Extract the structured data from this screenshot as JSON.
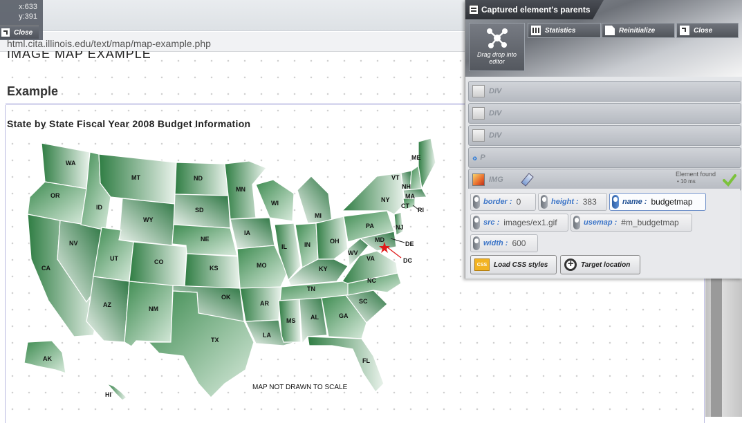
{
  "browser": {
    "url": "html.cita.illinois.edu/text/map/map-example.php"
  },
  "coords": {
    "x": "x:633",
    "y": "y:391",
    "close_label": "Close"
  },
  "page": {
    "heading_partial": "IMAGE MAP EXAMPLE",
    "section_title": "Example",
    "map_title": "State by State Fiscal Year 2008 Budget Information",
    "scale_note": "MAP NOT DRAWN TO SCALE",
    "state_labels": [
      "WA",
      "OR",
      "CA",
      "NV",
      "ID",
      "MT",
      "WY",
      "UT",
      "AZ",
      "CO",
      "NM",
      "ND",
      "SD",
      "NE",
      "KS",
      "OK",
      "TX",
      "MN",
      "IA",
      "MO",
      "AR",
      "LA",
      "WI",
      "IL",
      "MI",
      "IN",
      "OH",
      "KY",
      "TN",
      "MS",
      "AL",
      "GA",
      "FL",
      "SC",
      "NC",
      "VA",
      "WV",
      "PA",
      "NY",
      "VT",
      "NH",
      "ME",
      "MA",
      "CT",
      "RI",
      "NJ",
      "MD",
      "DE",
      "DC",
      "AK",
      "HI"
    ]
  },
  "panel": {
    "title": "Captured element's parents",
    "drag_drop_label": "Drag drop into editor",
    "statistics_label": "Statistics",
    "reinitialize_label": "Reinitialize",
    "close_label": "Close",
    "parents": [
      {
        "tag": "DIV"
      },
      {
        "tag": "DIV"
      },
      {
        "tag": "DIV"
      },
      {
        "tag": "P"
      },
      {
        "tag": "IMG"
      }
    ],
    "element_found": "Element found",
    "found_time": "10 ms",
    "attributes": {
      "border": {
        "key": "border :",
        "value": "0"
      },
      "height": {
        "key": "height :",
        "value": "383"
      },
      "name": {
        "key": "name :",
        "value": "budgetmap"
      },
      "src": {
        "key": "src :",
        "value": "images/ex1.gif"
      },
      "usemap": {
        "key": "usemap :",
        "value": "#m_budgetmap"
      },
      "width": {
        "key": "width :",
        "value": "600"
      }
    },
    "load_css_label": "Load CSS styles",
    "css_icon_text": "CSS",
    "target_location_label": "Target location"
  },
  "colors": {
    "map_green_dark": "#2f7d43",
    "map_green_light": "#eaf3ec",
    "accent_blue": "#3b74c7",
    "dc_marker": "#e01b1b"
  }
}
